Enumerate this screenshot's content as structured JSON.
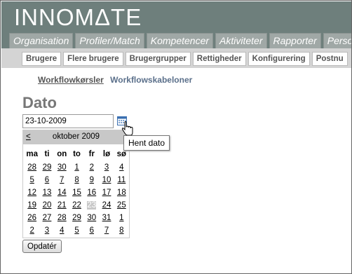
{
  "app": {
    "logo": "INNOMΔTE"
  },
  "main_tabs": [
    "Organisation",
    "Profiler/Match",
    "Kompetencer",
    "Aktiviteter",
    "Rapporter",
    "Perso"
  ],
  "sub_tabs": [
    "Brugere",
    "Flere brugere",
    "Brugergrupper",
    "Rettigheder",
    "Konfigurering",
    "Postnu"
  ],
  "workflow": {
    "active": "Workflowkørsler",
    "link": "Workflowskabeloner"
  },
  "page": {
    "title": "Dato"
  },
  "date_field": {
    "value": "23-10-2009"
  },
  "tooltip": "Hent dato",
  "calendar": {
    "prev": "<",
    "month_label": "oktober 2009",
    "weekdays": [
      "ma",
      "ti",
      "on",
      "to",
      "fr",
      "lø",
      "sø"
    ],
    "weeks": [
      [
        "28",
        "29",
        "30",
        "1",
        "2",
        "3",
        "4"
      ],
      [
        "5",
        "6",
        "7",
        "8",
        "9",
        "10",
        "11"
      ],
      [
        "12",
        "13",
        "14",
        "15",
        "16",
        "17",
        "18"
      ],
      [
        "19",
        "20",
        "21",
        "22",
        "23",
        "24",
        "25"
      ],
      [
        "26",
        "27",
        "28",
        "29",
        "30",
        "31",
        "1"
      ],
      [
        "2",
        "3",
        "4",
        "5",
        "6",
        "7",
        "8"
      ]
    ],
    "selected": "23"
  },
  "buttons": {
    "update": "Opdatér"
  }
}
